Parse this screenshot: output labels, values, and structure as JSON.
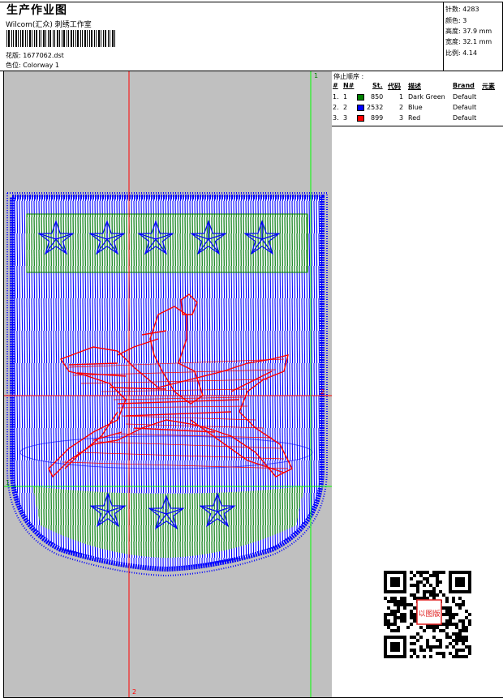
{
  "header": {
    "title": "生产作业图",
    "studio": "Wilcom(汇众) 刺绣工作室",
    "design_file": "花版: 1677062.dst",
    "colorway": "色位: Colorway 1"
  },
  "stats": [
    {
      "label": "针数",
      "value": "4283"
    },
    {
      "label": "颜色",
      "value": "3"
    },
    {
      "label": "高度",
      "value": "37.9 mm"
    },
    {
      "label": "宽度",
      "value": "32.1 mm"
    },
    {
      "label": "比例",
      "value": "4.14"
    }
  ],
  "stop_sequence": {
    "title": "停止顺序 :",
    "columns": [
      "#",
      "N#",
      "St.",
      "代码",
      "描述",
      "Brand",
      "元素"
    ],
    "rows": [
      {
        "index": "1.",
        "n": "1",
        "color": "#008000",
        "stitches": "850",
        "code": "1",
        "desc": "Dark Green",
        "brand": "Default"
      },
      {
        "index": "2.",
        "n": "2",
        "color": "#0000ff",
        "stitches": "2532",
        "code": "2",
        "desc": "Blue",
        "brand": "Default"
      },
      {
        "index": "3.",
        "n": "3",
        "color": "#ff0000",
        "stitches": "899",
        "code": "3",
        "desc": "Red",
        "brand": "Default"
      }
    ]
  },
  "guides": {
    "marker_top": "1",
    "marker_bottom": "2",
    "marker_left": "1",
    "marker_right": "2"
  },
  "qr": {
    "stamp_text": "以图版"
  },
  "colors": {
    "green": "#008000",
    "blue": "#0000ff",
    "red": "#ff0000",
    "canvas_bg": "#c0c0c0"
  }
}
